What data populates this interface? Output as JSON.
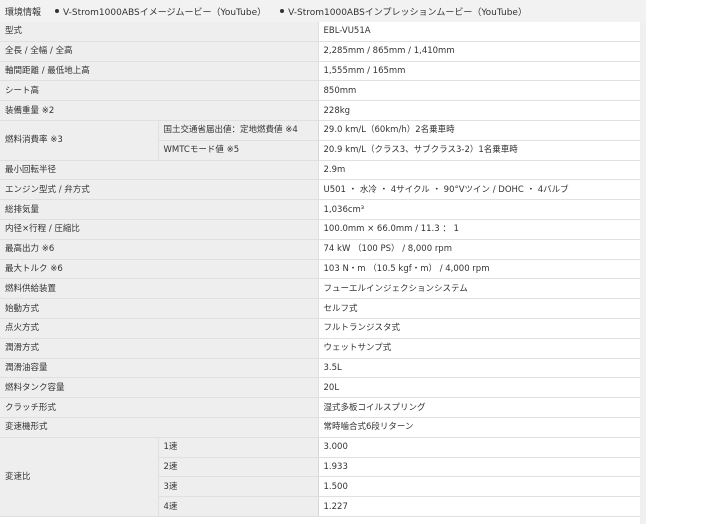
{
  "header_links": [
    {
      "label": "環境情報",
      "bullet": false
    },
    {
      "label": "V-Strom1000ABSイメージムービー（YouTube）",
      "bullet": true
    },
    {
      "label": "V-Strom1000ABSインプレッションムービー（YouTube）",
      "bullet": true
    }
  ],
  "specs": [
    {
      "label": "型式",
      "value": "EBL-VU51A"
    },
    {
      "label": "全長 / 全幅 / 全高",
      "value": "2,285mm / 865mm / 1,410mm"
    },
    {
      "label": "軸間距離 / 最低地上高",
      "value": "1,555mm / 165mm"
    },
    {
      "label": "シート高",
      "value": "850mm"
    },
    {
      "label": "装備重量 ※2",
      "value": "228kg"
    },
    {
      "label": "燃料消費率 ※3",
      "sub": [
        {
          "label": "国土交通省届出値：定地燃費値 ※4",
          "value": "29.0 km/L（60km/h）2名乗車時"
        },
        {
          "label": "WMTCモード値 ※5",
          "value": "20.9 km/L（クラス3、サブクラス3-2）1名乗車時"
        }
      ]
    },
    {
      "label": "最小回転半径",
      "value": "2.9m"
    },
    {
      "label": "エンジン型式 / 弁方式",
      "value": "U501 ・ 水冷 ・ 4サイクル ・ 90°Vツイン / DOHC ・ 4バルブ"
    },
    {
      "label": "総排気量",
      "value": "1,036cm³"
    },
    {
      "label": "内径×行程 / 圧縮比",
      "value": "100.0mm × 66.0mm / 11.3 ： 1"
    },
    {
      "label": "最高出力 ※6",
      "value": "74 kW （100 PS） / 8,000 rpm"
    },
    {
      "label": "最大トルク ※6",
      "value": "103 N・m （10.5 kgf・m） / 4,000 rpm"
    },
    {
      "label": "燃料供給装置",
      "value": "フューエルインジェクションシステム"
    },
    {
      "label": "始動方式",
      "value": "セルフ式"
    },
    {
      "label": "点火方式",
      "value": "フルトランジスタ式"
    },
    {
      "label": "潤滑方式",
      "value": "ウェットサンプ式"
    },
    {
      "label": "潤滑油容量",
      "value": "3.5L"
    },
    {
      "label": "燃料タンク容量",
      "value": "20L"
    },
    {
      "label": "クラッチ形式",
      "value": "湿式多板コイルスプリング"
    },
    {
      "label": "変速機形式",
      "value": "常時噛合式6段リターン"
    },
    {
      "label": "変速比",
      "sub": [
        {
          "label": "1速",
          "value": "3.000"
        },
        {
          "label": "2速",
          "value": "1.933"
        },
        {
          "label": "3速",
          "value": "1.500"
        },
        {
          "label": "4速",
          "value": "1.227"
        }
      ]
    }
  ]
}
